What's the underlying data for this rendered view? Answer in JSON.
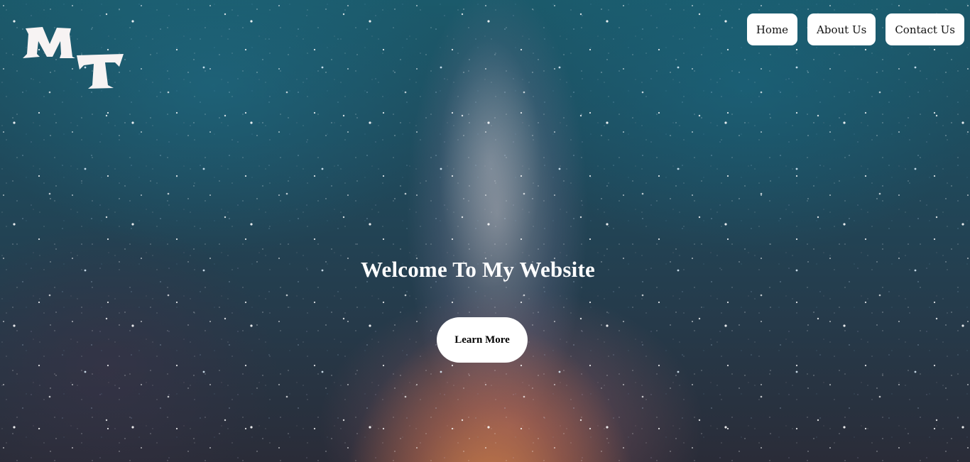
{
  "logo": {
    "text": "MT",
    "color": "#f7f3f3"
  },
  "nav": {
    "items": [
      {
        "label": "Home"
      },
      {
        "label": "About Us"
      },
      {
        "label": "Contact Us"
      }
    ]
  },
  "hero": {
    "headline": "Welcome To My Website",
    "cta_label": "Learn More",
    "background": "starry night sky with milky way"
  },
  "colors": {
    "button_bg": "#ffffff",
    "button_text": "#111111",
    "headline": "#ffffff"
  }
}
